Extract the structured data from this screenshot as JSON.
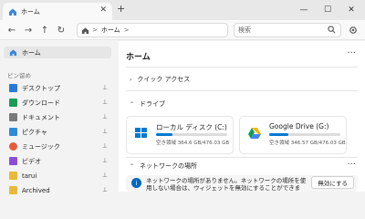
{
  "tab": {
    "title": "ホーム",
    "close": "✕"
  },
  "new_tab": "+",
  "window_controls": {
    "minimize": "—",
    "maximize": "☐",
    "close": "✕"
  },
  "nav": {
    "back": "←",
    "forward": "→",
    "up": "↑",
    "refresh": "↻"
  },
  "address": {
    "crumb": "ホーム",
    "separator": ">"
  },
  "search": {
    "placeholder": "検索",
    "icon": "search-icon"
  },
  "settings_icon": "gear-icon",
  "sidebar": {
    "home": "ホーム",
    "pinned_title": "ピン留め",
    "items": [
      {
        "label": "デスクトップ",
        "icon": "desktop-icon",
        "color": "#2b79d3"
      },
      {
        "label": "ダウンロード",
        "icon": "download-icon",
        "color": "#1a9b57"
      },
      {
        "label": "ドキュメント",
        "icon": "document-icon",
        "color": "#7a7a7a"
      },
      {
        "label": "ピクチャ",
        "icon": "picture-icon",
        "color": "#2e8bd6"
      },
      {
        "label": "ミュージック",
        "icon": "music-icon",
        "color": "#e55c3a"
      },
      {
        "label": "ビデオ",
        "icon": "video-icon",
        "color": "#8a4fd6"
      },
      {
        "label": "tarui",
        "icon": "folder-icon",
        "color": "#e8b93b"
      },
      {
        "label": "Archived",
        "icon": "folder-icon",
        "color": "#e8b93b"
      }
    ]
  },
  "main": {
    "title": "ホーム",
    "more": "···",
    "quick_access": "クイック アクセス",
    "drives_title": "ドライブ",
    "drives": [
      {
        "name": "ローカル ディスク (C:)",
        "free": "空き領域 364.6 GB/476.03 GB",
        "used_fraction": 0.234,
        "icon": "windows-drive-icon"
      },
      {
        "name": "Google Drive (G:)",
        "free": "空き領域 346.57 GB/476.03 GB",
        "used_fraction": 0.272,
        "icon": "google-drive-icon"
      }
    ],
    "network_title": "ネットワークの場所",
    "network_more": "···",
    "info_text": "ネットワークの場所がありません。ネットワークの場所を使用しない場合は、ウィジェットを無効にすることができます。",
    "disable_button": "無効にする"
  },
  "colors": {
    "accent": "#0078d4",
    "info": "#0067c0"
  }
}
